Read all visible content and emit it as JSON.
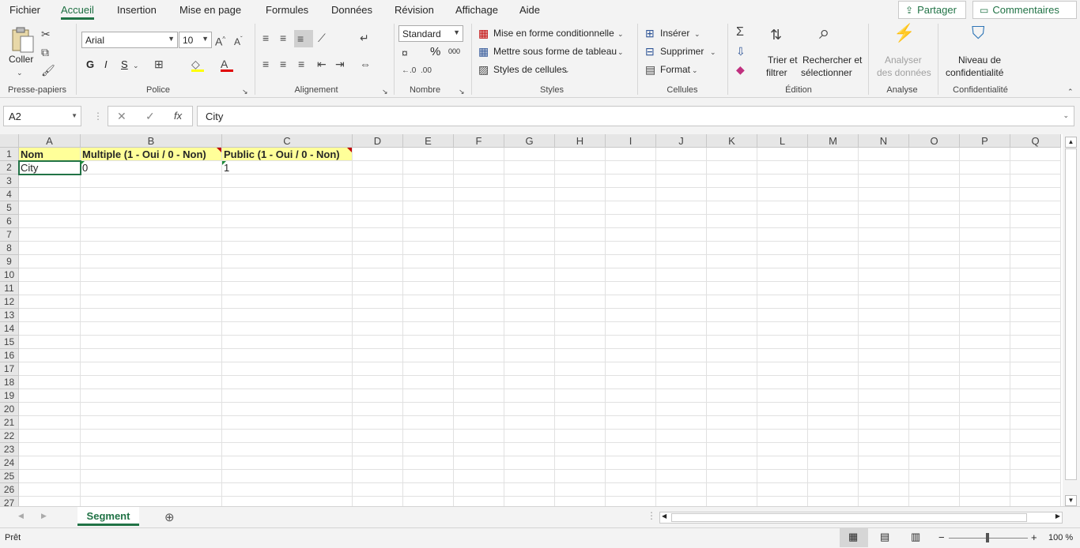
{
  "tabs": [
    "Fichier",
    "Accueil",
    "Insertion",
    "Mise en page",
    "Formules",
    "Données",
    "Révision",
    "Affichage",
    "Aide"
  ],
  "top_buttons": {
    "share": "Partager",
    "comments": "Commentaires"
  },
  "ribbon": {
    "clipboard": {
      "paste": "Coller",
      "label": "Presse-papiers"
    },
    "font": {
      "name": "Arial",
      "size": "10",
      "label": "Police",
      "bold": "G",
      "italic": "I",
      "underline": "S"
    },
    "alignment": {
      "label": "Alignement"
    },
    "number": {
      "format": "Standard",
      "label": "Nombre",
      "percent": "%",
      "thousands": "000"
    },
    "styles": {
      "cond": "Mise en forme conditionnelle",
      "table": "Mettre sous forme de tableau",
      "cell": "Styles de cellules",
      "label": "Styles"
    },
    "cells": {
      "insert": "Insérer",
      "delete": "Supprimer",
      "format": "Format",
      "label": "Cellules"
    },
    "editing": {
      "sort1": "Trier et",
      "sort2": "filtrer",
      "find1": "Rechercher et",
      "find2": "sélectionner",
      "label": "Édition"
    },
    "analysis": {
      "a1": "Analyser",
      "a2": "des données",
      "label": "Analyse"
    },
    "sensitivity": {
      "s1": "Niveau de",
      "s2": "confidentialité",
      "label": "Confidentialité"
    }
  },
  "formula_bar": {
    "name_box": "A2",
    "fx": "fx",
    "content": "City"
  },
  "columns": [
    "A",
    "B",
    "C",
    "D",
    "E",
    "F",
    "G",
    "H",
    "I",
    "J",
    "K",
    "L",
    "M",
    "N",
    "O",
    "P",
    "Q"
  ],
  "rows": [
    "1",
    "2",
    "3",
    "4",
    "5",
    "6",
    "7",
    "8",
    "9",
    "10",
    "11",
    "12",
    "13",
    "14",
    "15",
    "16",
    "17",
    "18",
    "19",
    "20",
    "21",
    "22",
    "23",
    "24",
    "25",
    "26",
    "27"
  ],
  "cells": {
    "A1": "Nom",
    "B1": "Multiple (1 - Oui / 0 - Non)",
    "C1": "Public (1 - Oui / 0 - Non)",
    "A2": "City",
    "B2": "0",
    "C2": "1"
  },
  "sheet_tab": "Segment",
  "status": {
    "ready": "Prêt",
    "zoom": "100 %"
  },
  "colors": {
    "accent": "#217346",
    "header_fill": "#ffff99"
  }
}
